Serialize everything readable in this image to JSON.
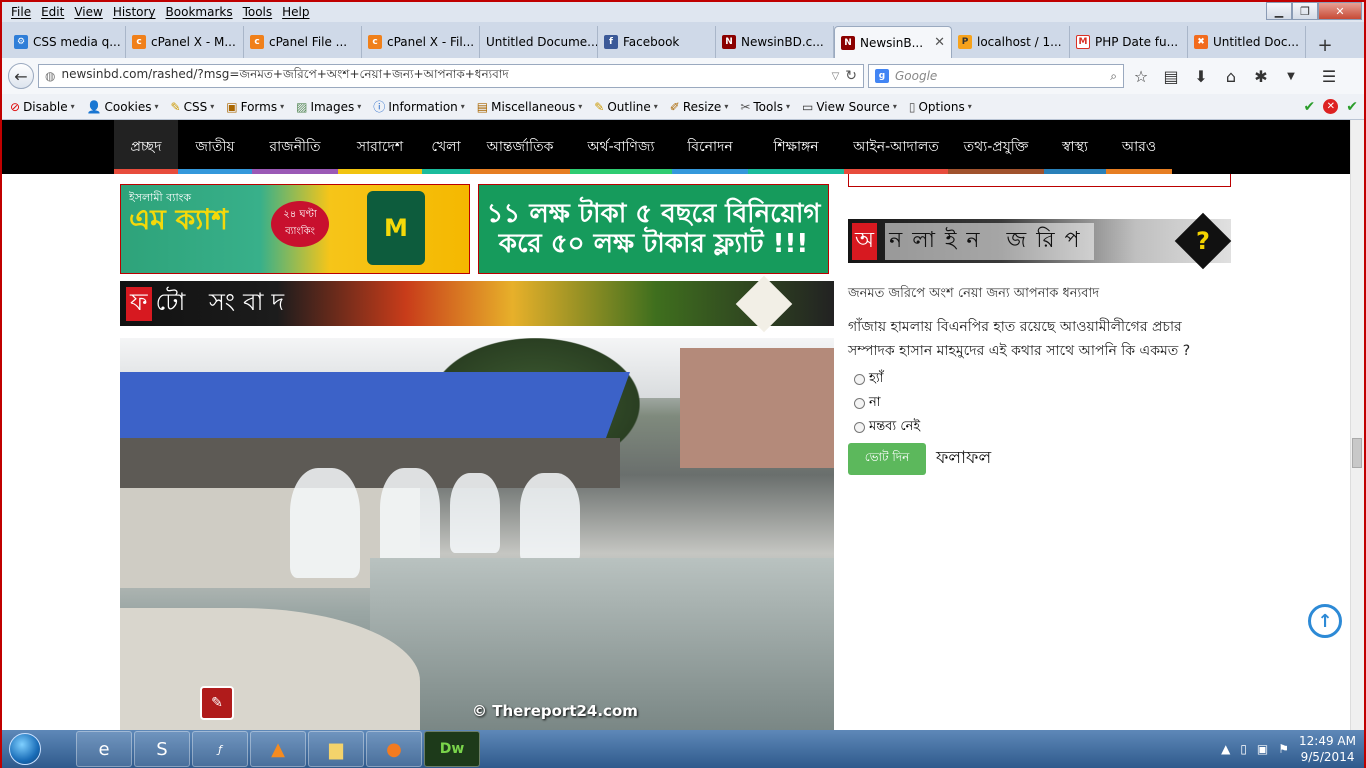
{
  "browser": {
    "menu": [
      "File",
      "Edit",
      "View",
      "History",
      "Bookmarks",
      "Tools",
      "Help"
    ],
    "tabs": [
      {
        "label": "CSS media q...",
        "icon": "css-icon"
      },
      {
        "label": "cPanel X - M...",
        "icon": "cpanel-icon"
      },
      {
        "label": "cPanel File ...",
        "icon": "cpanel-icon"
      },
      {
        "label": "cPanel X - Fil...",
        "icon": "cpanel-icon"
      },
      {
        "label": "Untitled Docume...",
        "icon": "none"
      },
      {
        "label": "Facebook",
        "icon": "facebook-icon"
      },
      {
        "label": "NewsinBD.c...",
        "icon": "newsinbd-icon"
      },
      {
        "label": "NewsinB...",
        "icon": "newsinbd-icon",
        "active": true
      },
      {
        "label": "localhost / 1...",
        "icon": "phpmyadmin-icon"
      },
      {
        "label": "PHP Date fu...",
        "icon": "gmail-icon"
      },
      {
        "label": "Untitled Doc...",
        "icon": "xampp-icon"
      }
    ],
    "url": "newsinbd.com/rashed/?msg=জনমত+জরিপে+অংশ+নেয়া+জন্য+আপনাক+ধন্যবাদ",
    "search_placeholder": "Google",
    "devtoolbar": [
      {
        "label": "Disable",
        "icon": "disable-icon"
      },
      {
        "label": "Cookies",
        "icon": "cookie-icon"
      },
      {
        "label": "CSS",
        "icon": "css-pencil-icon"
      },
      {
        "label": "Forms",
        "icon": "forms-icon"
      },
      {
        "label": "Images",
        "icon": "images-icon"
      },
      {
        "label": "Information",
        "icon": "info-icon"
      },
      {
        "label": "Miscellaneous",
        "icon": "misc-icon"
      },
      {
        "label": "Outline",
        "icon": "outline-icon"
      },
      {
        "label": "Resize",
        "icon": "resize-icon"
      },
      {
        "label": "Tools",
        "icon": "tools-icon"
      },
      {
        "label": "View Source",
        "icon": "source-icon"
      },
      {
        "label": "Options",
        "icon": "options-icon"
      }
    ]
  },
  "site": {
    "nav": [
      {
        "label": "প্রচ্ছদ",
        "color": "#e74c3c",
        "active": true
      },
      {
        "label": "জাতীয়",
        "color": "#3498db"
      },
      {
        "label": "রাজনীতি",
        "color": "#9b59b6"
      },
      {
        "label": "সারাদেশ",
        "color": "#f1c40f"
      },
      {
        "label": "খেলা",
        "color": "#1abc9c"
      },
      {
        "label": "আন্তর্জাতিক",
        "color": "#e67e22"
      },
      {
        "label": "অর্থ-বাণিজ্য",
        "color": "#2ecc71"
      },
      {
        "label": "বিনোদন",
        "color": "#3498db"
      },
      {
        "label": "শিক্ষাঙ্গন",
        "color": "#1abc9c"
      },
      {
        "label": "আইন-আদালত",
        "color": "#e74c3c"
      },
      {
        "label": "তথ্য-প্রযুক্তি",
        "color": "#a0522d"
      },
      {
        "label": "স্বাস্থ্য",
        "color": "#2980b9"
      },
      {
        "label": "আরও",
        "color": "#e67e22"
      }
    ],
    "ad1": {
      "title": "এম ক্যাশ",
      "badge": "২৪ ঘণ্টা ব্যাংকিং",
      "bank": "ইসলামী ব্যাংক"
    },
    "ad2": {
      "text": "১১ লক্ষ টাকা ৫ বছরে বিনিয়োগ করে ৫০ লক্ষ টাকার ফ্ল্যাট !!!"
    },
    "photo_band": {
      "first": "ফ",
      "rest": "টো সংবাদ"
    },
    "photo_credit": "© Thereport24.com",
    "online_band": {
      "first": "অ",
      "rest": "নলাইন জরিপ"
    },
    "poll": {
      "thanks": "জনমত জরিপে অংশ নেয়া জন্য আপনাক ধন্যবাদ",
      "question": "গাঁজায় হামলায় বিএনপির হাত রয়েছে আওয়ামীলীগের প্রচার সম্পাদক হাসান মাহমুদের এই কথার সাথে আপনি কি একমত ?",
      "options": [
        "হ্যাঁ",
        "না",
        "মন্তব্য নেই"
      ],
      "vote_label": "ভোট দিন",
      "result_label": "ফলাফল"
    }
  },
  "taskbar": {
    "apps": [
      "ie-icon",
      "skype-icon",
      "flash-icon",
      "vlc-icon",
      "explorer-icon",
      "firefox-icon",
      "dreamweaver-icon"
    ],
    "time": "12:49 AM",
    "date": "9/5/2014"
  }
}
